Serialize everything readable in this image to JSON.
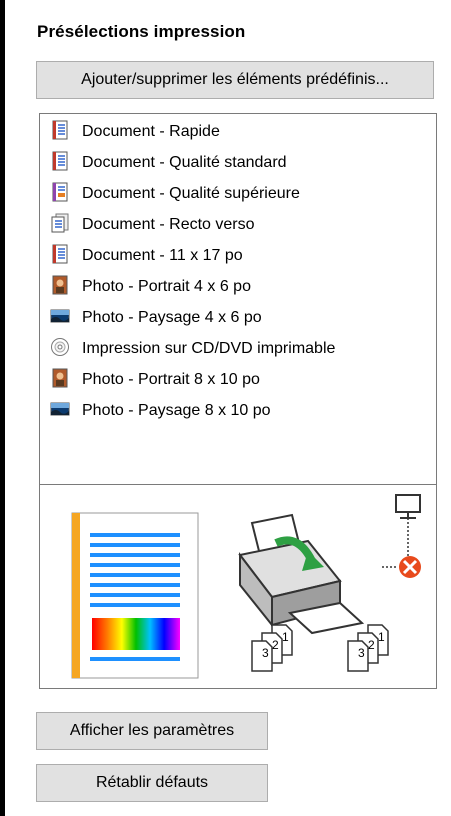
{
  "panel": {
    "title": "Présélections impression",
    "add_button_label": "Ajouter/supprimer les éléments prédéfinis...",
    "presets": [
      {
        "label": "Document - Rapide",
        "icon": "document-icon"
      },
      {
        "label": "Document - Qualité standard",
        "icon": "document-icon"
      },
      {
        "label": "Document - Qualité supérieure",
        "icon": "document-hq-icon"
      },
      {
        "label": "Document - Recto verso",
        "icon": "document-duplex-icon"
      },
      {
        "label": "Document - 11 x 17 po",
        "icon": "document-icon"
      },
      {
        "label": "Photo - Portrait 4 x 6 po",
        "icon": "photo-portrait-icon"
      },
      {
        "label": "Photo - Paysage 4 x 6 po",
        "icon": "photo-landscape-icon"
      },
      {
        "label": "Impression sur CD/DVD imprimable",
        "icon": "cd-icon"
      },
      {
        "label": "Photo - Portrait 8 x 10 po",
        "icon": "photo-portrait-icon"
      },
      {
        "label": "Photo - Paysage 8 x 10 po",
        "icon": "photo-landscape-icon"
      }
    ],
    "show_settings_label": "Afficher les paramètres",
    "reset_defaults_label": "Rétablir défauts",
    "collate_icons": [
      {
        "labels": [
          "3",
          "2",
          "1"
        ]
      },
      {
        "labels": [
          "3",
          "2",
          "1"
        ]
      }
    ]
  },
  "colors": {
    "accent_orange": "#f5a623",
    "doc_blue": "#1e90ff",
    "button_bg": "#e1e1e1",
    "error_red": "#e84a1c",
    "printer_green": "#2ea043"
  }
}
